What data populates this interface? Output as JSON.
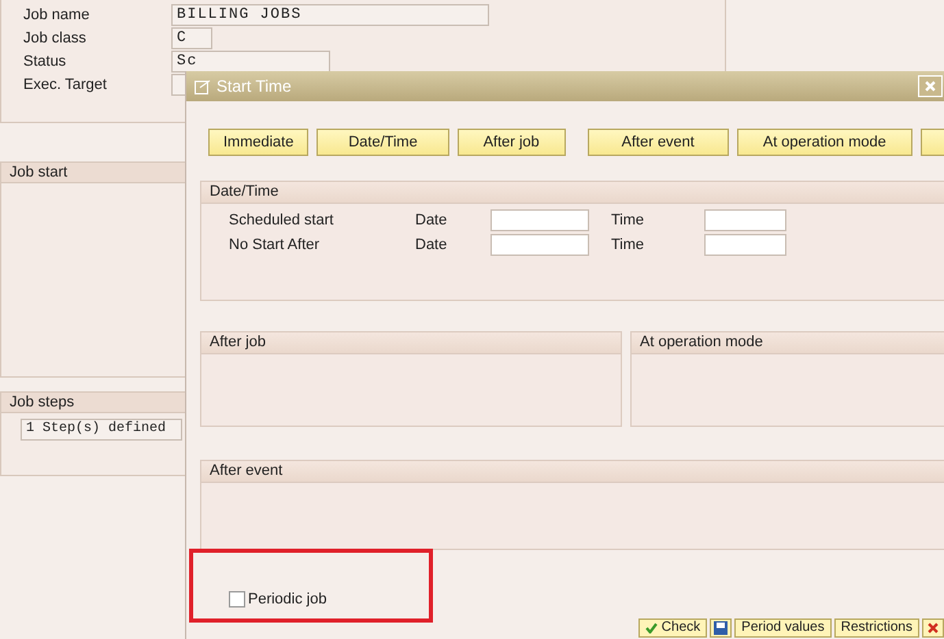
{
  "job_header": {
    "fields": [
      {
        "label": "Job name",
        "value": "BILLING JOBS"
      },
      {
        "label": "Job class",
        "value": "C"
      },
      {
        "label": "Status",
        "value": "Sc"
      },
      {
        "label": "Exec. Target"
      }
    ]
  },
  "sections": [
    {
      "title": "Job start"
    },
    {
      "title": "Job steps",
      "value": "1 Step(s) defined"
    }
  ],
  "dialog": {
    "title": "Start Time",
    "buttons": [
      "Immediate",
      "Date/Time",
      "After job",
      "After event",
      "At operation mode"
    ],
    "date_time": {
      "title": "Date/Time",
      "rows": [
        {
          "label": "Scheduled start",
          "date_label": "Date",
          "time_label": "Time"
        },
        {
          "label": "No Start After",
          "date_label": "Date",
          "time_label": "Time"
        }
      ]
    },
    "after_job": {
      "title": "After job"
    },
    "operation_mode": {
      "title": "At operation mode"
    },
    "after_event": {
      "title": "After event"
    },
    "periodic_job": {
      "label": "Periodic job",
      "checked": false
    },
    "footer_buttons": [
      "Check",
      "Period values",
      "Restrictions"
    ]
  }
}
